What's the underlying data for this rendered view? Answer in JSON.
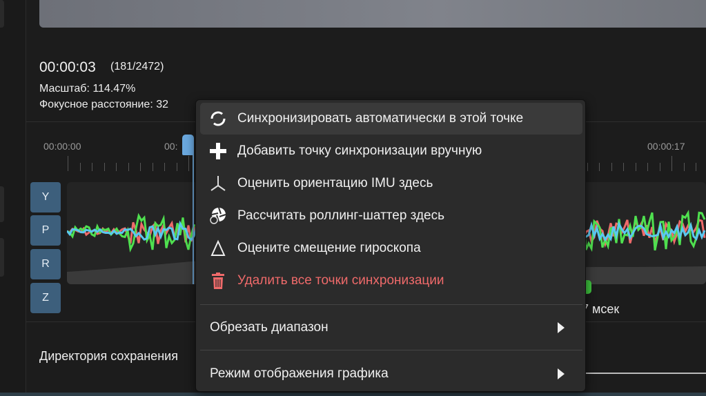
{
  "info": {
    "time": "00:00:03",
    "frames": "(181/2472)",
    "scale": "Масштаб: 114.47%",
    "focal": "Фокусное расстояние: 32"
  },
  "timeline": {
    "labels": [
      "00:00:00",
      "00:",
      "00:00:17"
    ]
  },
  "axes": [
    "Y",
    "P",
    "R",
    "Z"
  ],
  "offset_text": "7 мсек",
  "save_dir_label": "Директория сохранения",
  "menu": {
    "items": [
      {
        "label": "Синхронизировать автоматически в этой точке",
        "icon": "sync-icon"
      },
      {
        "label": "Добавить точку синхронизации вручную",
        "icon": "plus-icon"
      },
      {
        "label": "Оценить ориентацию IMU здесь",
        "icon": "axes-icon"
      },
      {
        "label": "Рассчитать роллинг-шаттер здесь",
        "icon": "shutter-icon"
      },
      {
        "label": "Оцените смещение гироскопа",
        "icon": "delta-icon"
      },
      {
        "label": "Удалить все точки синхронизации",
        "icon": "trash-icon",
        "color": "#ef6a6a"
      }
    ],
    "submenus": [
      {
        "label": "Обрезать диапазон"
      },
      {
        "label": "Режим отображения графика"
      }
    ]
  },
  "colors": {
    "accent": "#6aa8de",
    "axis_button": "#3d5f7c",
    "danger": "#ef6a6a",
    "series": [
      "#ef6a6a",
      "#4fe04f",
      "#5ac8f0"
    ]
  }
}
